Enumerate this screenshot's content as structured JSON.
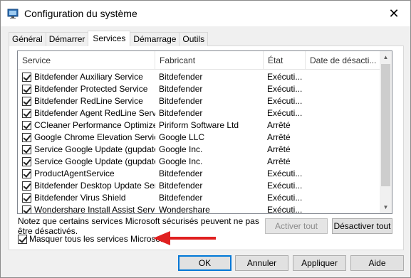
{
  "window": {
    "title": "Configuration du système",
    "close_glyph": "✕",
    "icon": "system-config-icon"
  },
  "tabs": [
    {
      "label": "Général"
    },
    {
      "label": "Démarrer"
    },
    {
      "label": "Services",
      "active": true
    },
    {
      "label": "Démarrage"
    },
    {
      "label": "Outils"
    }
  ],
  "table": {
    "columns": [
      "Service",
      "Fabricant",
      "État",
      "Date de désacti..."
    ],
    "rows": [
      {
        "name": "Bitdefender Auxiliary Service",
        "maker": "Bitdefender",
        "state": "Exécuti...",
        "checked": true
      },
      {
        "name": "Bitdefender Protected Service",
        "maker": "Bitdefender",
        "state": "Exécuti...",
        "checked": true
      },
      {
        "name": "Bitdefender RedLine Service",
        "maker": "Bitdefender",
        "state": "Exécuti...",
        "checked": true
      },
      {
        "name": "Bitdefender Agent RedLine Service",
        "maker": "Bitdefender",
        "state": "Exécuti...",
        "checked": true
      },
      {
        "name": "CCleaner Performance Optimizer...",
        "maker": "Piriform Software Ltd",
        "state": "Arrêté",
        "checked": true
      },
      {
        "name": "Google Chrome Elevation Servic...",
        "maker": "Google LLC",
        "state": "Arrêté",
        "checked": true
      },
      {
        "name": "Service Google Update (gupdate)",
        "maker": "Google Inc.",
        "state": "Arrêté",
        "checked": true
      },
      {
        "name": "Service Google Update (gupdatem)",
        "maker": "Google Inc.",
        "state": "Arrêté",
        "checked": true
      },
      {
        "name": "ProductAgentService",
        "maker": "Bitdefender",
        "state": "Exécuti...",
        "checked": true
      },
      {
        "name": "Bitdefender Desktop Update Ser...",
        "maker": "Bitdefender",
        "state": "Exécuti...",
        "checked": true
      },
      {
        "name": "Bitdefender Virus Shield",
        "maker": "Bitdefender",
        "state": "Exécuti...",
        "checked": true
      },
      {
        "name": "Wondershare Install Assist Service",
        "maker": "Wondershare",
        "state": "Exécuti...",
        "checked": true
      }
    ]
  },
  "note": "Notez que certains services Microsoft sécurisés peuvent ne pas être désactivés.",
  "buttons": {
    "enable_all": "Activer tout",
    "disable_all": "Désactiver tout",
    "ok": "OK",
    "cancel": "Annuler",
    "apply": "Appliquer",
    "help": "Aide"
  },
  "hide_ms": {
    "label": "Masquer tous les services Microsoft",
    "checked": true
  },
  "colors": {
    "annotation_arrow": "#e02020",
    "accent": "#0078d7"
  }
}
